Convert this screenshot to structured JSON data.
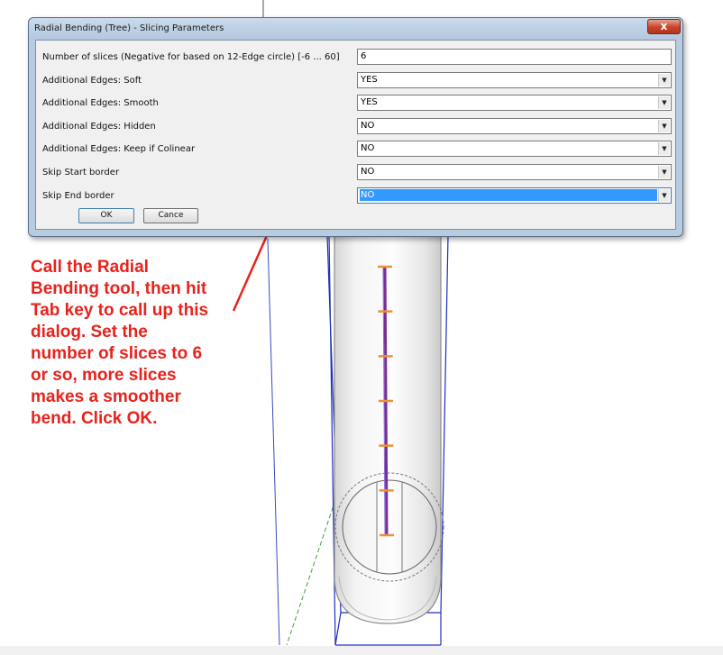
{
  "dialog": {
    "title": "Radial Bending (Tree) - Slicing Parameters",
    "close_glyph": "x",
    "fields": [
      {
        "label": "Number of slices (Negative for based on 12-Edge circle)  [-6 ... 60]",
        "value": "6",
        "type": "text"
      },
      {
        "label": "Additional Edges: Soft",
        "value": "YES",
        "type": "dropdown"
      },
      {
        "label": "Additional Edges: Smooth",
        "value": "YES",
        "type": "dropdown"
      },
      {
        "label": "Additional Edges: Hidden",
        "value": "NO",
        "type": "dropdown"
      },
      {
        "label": "Additional Edges: Keep if Colinear",
        "value": "NO",
        "type": "dropdown"
      },
      {
        "label": "Skip Start border",
        "value": "NO",
        "type": "dropdown"
      },
      {
        "label": "Skip End border",
        "value": "NO",
        "type": "dropdown",
        "selected": true
      }
    ],
    "ok_label": "OK",
    "cancel_label": "Cance"
  },
  "annotation": {
    "lines": [
      "Call the Radial",
      "Bending tool, then hit",
      "Tab key to call up this",
      "dialog.  Set the",
      "number of slices to 6",
      "or so, more slices",
      "makes a smoother",
      "bend.  Click OK."
    ],
    "color": "#e8221c"
  },
  "colors": {
    "arrow": "#e8221c",
    "axis_line": "#8a6fd1",
    "divisions": "#f0902e",
    "bounding_box": "#1f2fc0",
    "green_axis": "#3aa33a",
    "selection": "#3399ff"
  },
  "viewport": {
    "division_marks": 7
  }
}
